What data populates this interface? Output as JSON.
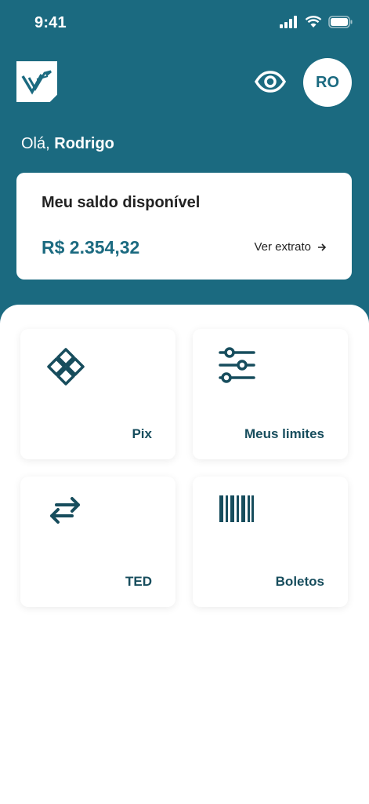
{
  "status_bar": {
    "time": "9:41"
  },
  "header": {
    "avatar_initials": "RO",
    "greeting_prefix": "Olá,",
    "user_name": "Rodrigo"
  },
  "balance": {
    "title": "Meu saldo disponível",
    "amount": "R$ 2.354,32",
    "statement_link": "Ver extrato"
  },
  "shortcuts": [
    {
      "label": "Pix",
      "icon": "pix-icon"
    },
    {
      "label": "Meus limites",
      "icon": "sliders-icon"
    },
    {
      "label": "TED",
      "icon": "transfer-arrows-icon"
    },
    {
      "label": "Boletos",
      "icon": "barcode-icon"
    }
  ],
  "colors": {
    "primary": "#1b6a80",
    "label_dark": "#174d5d"
  }
}
